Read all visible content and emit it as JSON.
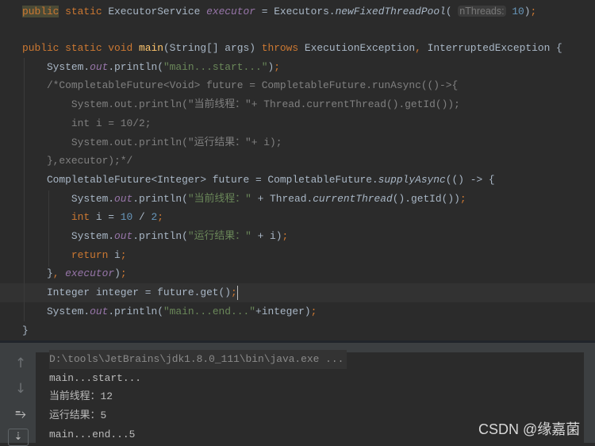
{
  "editor": {
    "lines": [
      {
        "tokens": [
          {
            "t": "public",
            "c": "kw hl"
          },
          {
            "t": " static ",
            "c": "kw"
          },
          {
            "t": "ExecutorService ",
            "c": "tx"
          },
          {
            "t": "executor",
            "c": "fld"
          },
          {
            "t": " = Executors.",
            "c": "tx"
          },
          {
            "t": "newFixedThreadPool",
            "c": "itm"
          },
          {
            "t": "( ",
            "c": "tx"
          },
          {
            "t": "nThreads:",
            "c": "hint"
          },
          {
            "t": " 10",
            "c": "num"
          },
          {
            "t": ")",
            "c": "tx"
          },
          {
            "t": ";",
            "c": "kw"
          }
        ]
      },
      {
        "tokens": []
      },
      {
        "tokens": [
          {
            "t": "public static void ",
            "c": "kw"
          },
          {
            "t": "main",
            "c": "mdecl"
          },
          {
            "t": "(String[] args) ",
            "c": "tx"
          },
          {
            "t": "throws ",
            "c": "kw"
          },
          {
            "t": "ExecutionException",
            "c": "tx"
          },
          {
            "t": ", ",
            "c": "kw"
          },
          {
            "t": "InterruptedException {",
            "c": "tx"
          }
        ]
      },
      {
        "tokens": [
          {
            "t": "    System.",
            "c": "tx"
          },
          {
            "t": "out",
            "c": "fld"
          },
          {
            "t": ".println(",
            "c": "tx"
          },
          {
            "t": "\"main...start...\"",
            "c": "str"
          },
          {
            "t": ")",
            "c": "tx"
          },
          {
            "t": ";",
            "c": "kw"
          }
        ]
      },
      {
        "tokens": [
          {
            "t": "    /*CompletableFuture<Void> future = CompletableFuture.runAsync(()->{",
            "c": "cm"
          }
        ]
      },
      {
        "tokens": [
          {
            "t": "        System.out.println(\"当前线程：\"+ Thread.currentThread().getId());",
            "c": "cm"
          }
        ]
      },
      {
        "tokens": [
          {
            "t": "        int i = 10/2;",
            "c": "cm"
          }
        ]
      },
      {
        "tokens": [
          {
            "t": "        System.out.println(\"运行结果：\"+ i);",
            "c": "cm"
          }
        ]
      },
      {
        "tokens": [
          {
            "t": "    },executor);*/",
            "c": "cm"
          }
        ]
      },
      {
        "tokens": [
          {
            "t": "    CompletableFuture<Integer> future = CompletableFuture.",
            "c": "tx"
          },
          {
            "t": "supplyAsync",
            "c": "itm"
          },
          {
            "t": "(() -> {",
            "c": "tx"
          }
        ]
      },
      {
        "tokens": [
          {
            "t": "        System.",
            "c": "tx"
          },
          {
            "t": "out",
            "c": "fld"
          },
          {
            "t": ".println(",
            "c": "tx"
          },
          {
            "t": "\"当前线程：\"",
            "c": "str"
          },
          {
            "t": " + Thread.",
            "c": "tx"
          },
          {
            "t": "currentThread",
            "c": "itm"
          },
          {
            "t": "().getId())",
            "c": "tx"
          },
          {
            "t": ";",
            "c": "kw"
          }
        ]
      },
      {
        "tokens": [
          {
            "t": "        int ",
            "c": "kw"
          },
          {
            "t": "i = ",
            "c": "tx"
          },
          {
            "t": "10",
            "c": "num"
          },
          {
            "t": " / ",
            "c": "tx"
          },
          {
            "t": "2",
            "c": "num"
          },
          {
            "t": ";",
            "c": "kw"
          }
        ]
      },
      {
        "tokens": [
          {
            "t": "        System.",
            "c": "tx"
          },
          {
            "t": "out",
            "c": "fld"
          },
          {
            "t": ".println(",
            "c": "tx"
          },
          {
            "t": "\"运行结果：\"",
            "c": "str"
          },
          {
            "t": " + i)",
            "c": "tx"
          },
          {
            "t": ";",
            "c": "kw"
          }
        ]
      },
      {
        "tokens": [
          {
            "t": "        return ",
            "c": "kw"
          },
          {
            "t": "i",
            "c": "tx"
          },
          {
            "t": ";",
            "c": "kw"
          }
        ]
      },
      {
        "tokens": [
          {
            "t": "    }",
            "c": "tx"
          },
          {
            "t": ", ",
            "c": "kw"
          },
          {
            "t": "executor",
            "c": "fld"
          },
          {
            "t": ")",
            "c": "tx"
          },
          {
            "t": ";",
            "c": "kw"
          }
        ]
      },
      {
        "tokens": [
          {
            "t": "    Integer integer = future.get()",
            "c": "tx"
          },
          {
            "t": ";",
            "c": "kw"
          }
        ],
        "caret": true
      },
      {
        "tokens": [
          {
            "t": "    System.",
            "c": "tx"
          },
          {
            "t": "out",
            "c": "fld"
          },
          {
            "t": ".println(",
            "c": "tx"
          },
          {
            "t": "\"main...end...\"",
            "c": "str"
          },
          {
            "t": "+integer)",
            "c": "tx"
          },
          {
            "t": ";",
            "c": "kw"
          }
        ]
      },
      {
        "tokens": [
          {
            "t": "}",
            "c": "tx"
          }
        ]
      }
    ]
  },
  "console": {
    "command": "D:\\tools\\JetBrains\\jdk1.8.0_111\\bin\\java.exe ...",
    "output": [
      "main...start...",
      "当前线程：12",
      "运行结果：5",
      "main...end...5"
    ]
  },
  "gutter_icons": [
    "arrow-up-icon",
    "arrow-down-icon",
    "soft-wrap-icon",
    "scroll-to-end-icon"
  ],
  "watermark": "CSDN @缘嘉菌",
  "colors": {
    "background": "#2b2b2b",
    "keyword": "#cc7832",
    "string": "#6a8759",
    "number": "#6897bb",
    "field": "#9876aa",
    "comment": "#808080",
    "method": "#ffc66d"
  }
}
